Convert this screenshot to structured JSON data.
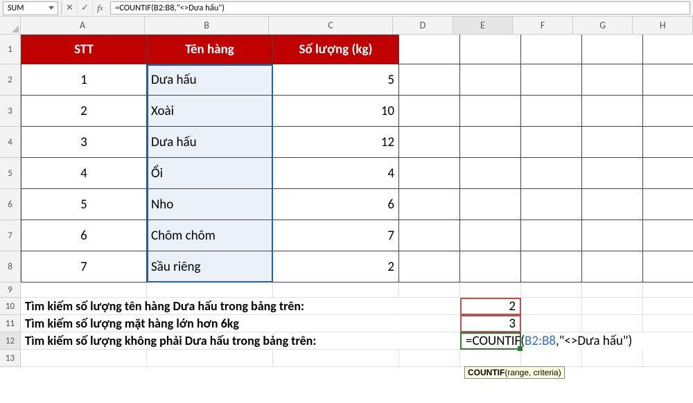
{
  "namebox": {
    "value": "SUM"
  },
  "formula_bar": {
    "text": "=COUNTIF(B2:B8,\"<>Dưa hấu\")"
  },
  "columns": {
    "letters": [
      "A",
      "B",
      "C",
      "D",
      "E",
      "F",
      "G",
      "H"
    ],
    "widths": [
      182,
      182,
      182,
      88,
      88,
      88,
      88,
      88
    ]
  },
  "row_heights": {
    "header": 43,
    "data": 45,
    "r9": 22,
    "r10": 25,
    "r11": 25,
    "r12": 25,
    "r13": 25
  },
  "table": {
    "headers": {
      "stt": "STT",
      "name": "Tên hàng",
      "qty": "Số lượng (kg)"
    },
    "rows": [
      {
        "stt": "1",
        "name": "Dưa hấu",
        "qty": "5"
      },
      {
        "stt": "2",
        "name": "Xoài",
        "qty": "10"
      },
      {
        "stt": "3",
        "name": "Dưa hấu",
        "qty": "12"
      },
      {
        "stt": "4",
        "name": "Ổi",
        "qty": "4"
      },
      {
        "stt": "5",
        "name": "Nho",
        "qty": "6"
      },
      {
        "stt": "6",
        "name": "Chôm chôm",
        "qty": "7"
      },
      {
        "stt": "7",
        "name": "Sầu riêng",
        "qty": "2"
      }
    ]
  },
  "queries": {
    "q1": {
      "label": "Tìm kiếm số lượng tên hàng Dưa hấu trong bảng trên:",
      "result": "2"
    },
    "q2": {
      "label": "Tìm kiếm số lượng mặt hàng lớn hơn 6kg",
      "result": "3"
    },
    "q3": {
      "label": "Tìm kiếm số lượng không phải Dưa hấu trong bảng trên:",
      "formula_parts": {
        "eq": "=",
        "fn": "COUNTIF",
        "open": "(",
        "range": "B2:B8",
        "sep": ",\"<>Dưa hấu\"",
        "close": ")"
      }
    }
  },
  "tooltip": {
    "bold": "COUNTIF",
    "rest": "(range, criteria)"
  }
}
